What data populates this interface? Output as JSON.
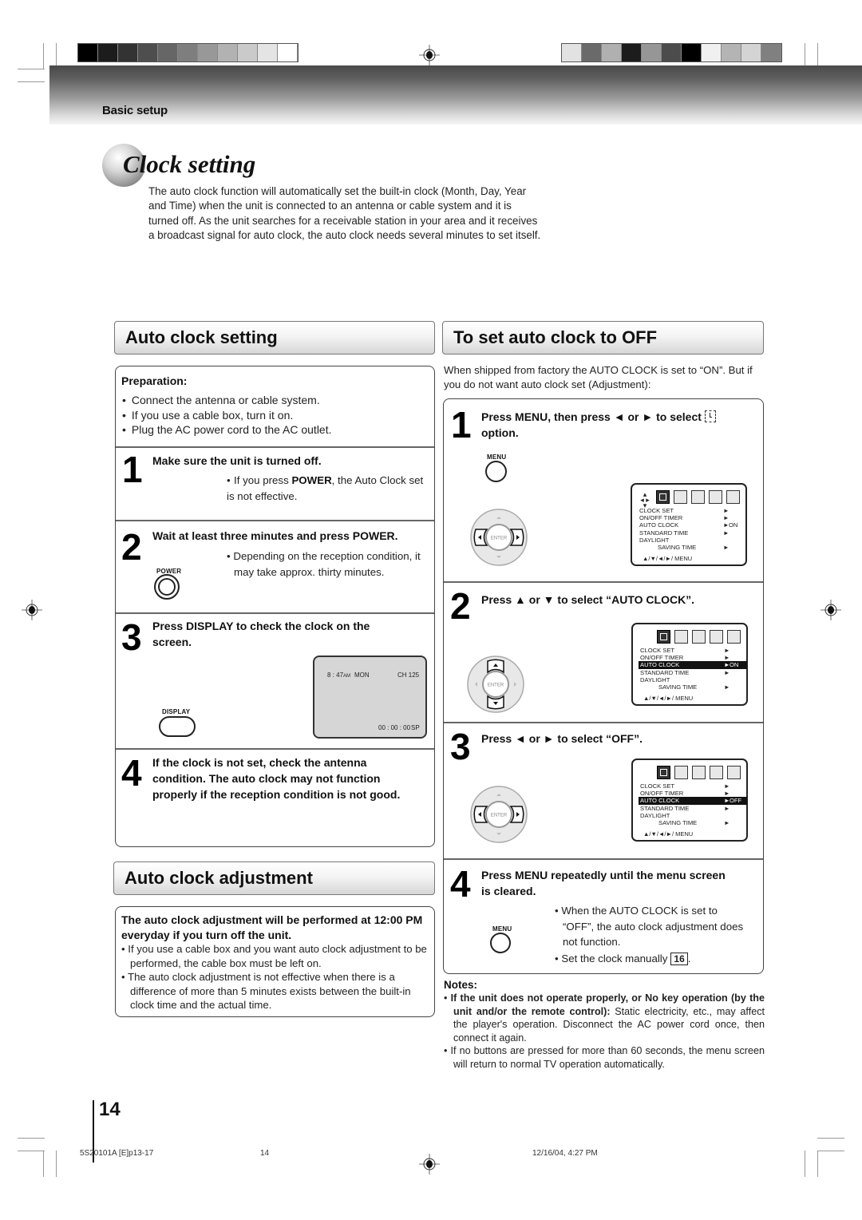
{
  "header": {
    "section_label": "Basic setup",
    "calibration_left": [
      "#000000",
      "#1c1c1c",
      "#333333",
      "#4e4e4e",
      "#666666",
      "#7e7e7e",
      "#989898",
      "#b2b2b2",
      "#cacaca",
      "#e4e4e4",
      "#ffffff"
    ],
    "calibration_right": [
      "#e2e2e2",
      "#6a6a6a",
      "#b0b0b0",
      "#1c1c1c",
      "#969696",
      "#4c4c4c",
      "#000000",
      "#f0f0f0",
      "#b4b4b4",
      "#d4d4d4",
      "#808080"
    ]
  },
  "title": "Clock setting",
  "intro": "The auto clock function will automatically set the built-in clock (Month, Day, Year and Time) when the unit is connected to an antenna or cable system and it is turned off. As the unit searches for a receivable station in your area and it receives a broadcast signal for auto clock, the auto clock needs several minutes to set itself.",
  "auto_clock_setting": {
    "heading": "Auto clock setting",
    "preparation": {
      "heading": "Preparation:",
      "items": [
        "Connect the antenna or cable system.",
        "If you use a cable box, turn it on.",
        "Plug the AC power cord to the AC outlet."
      ]
    },
    "steps": [
      {
        "number": "1",
        "title": "Make sure the unit is turned off.",
        "note_prefix": "If you press ",
        "note_bold": "POWER",
        "note_suffix": ", the Auto Clock set is not effective."
      },
      {
        "number": "2",
        "title": "Wait at least three minutes and press POWER.",
        "note": "Depending on the reception condition, it may take approx. thirty minutes.",
        "button_label": "POWER"
      },
      {
        "number": "3",
        "title": "Press DISPLAY to check the clock on the screen.",
        "button_label": "DISPLAY",
        "screen": {
          "time": "8 : 47",
          "ampm": "AM",
          "day": "MON",
          "channel": "CH  125",
          "counter": "00 : 00 : 00",
          "speed": "SP"
        }
      },
      {
        "number": "4",
        "title": "If the clock is not set, check the antenna condition. The auto clock may not function properly if the reception condition is not good."
      }
    ]
  },
  "auto_clock_adjustment": {
    "heading": "Auto clock adjustment",
    "lead": "The auto clock adjustment will be performed at 12:00 PM everyday if you turn off the unit.",
    "items": [
      "If you use a cable box and you want auto clock adjustment to be performed, the cable box must be left on.",
      "The auto clock adjustment is not effective when there is a difference of more than 5 minutes exists between the built-in clock time and the actual time."
    ]
  },
  "auto_clock_off": {
    "heading": "To set auto clock to OFF",
    "intro": "When shipped from factory the AUTO CLOCK is set to “ON”. But if you do not want auto clock set (Adjustment):",
    "steps": [
      {
        "number": "1",
        "title_a": "Press MENU, then press ◄ or ► to select",
        "title_b": "option.",
        "button_label": "MENU",
        "auto_clock_value": "ON",
        "highlight": false
      },
      {
        "number": "2",
        "title": "Press ▲ or ▼ to select “AUTO CLOCK”.",
        "auto_clock_value": "ON",
        "highlight": true
      },
      {
        "number": "3",
        "title": "Press ◄ or ► to select “OFF”.",
        "auto_clock_value": "OFF",
        "highlight": true
      },
      {
        "number": "4",
        "title": "Press MENU repeatedly until the menu screen is cleared.",
        "button_label": "MENU",
        "notes": [
          "When the AUTO CLOCK is set to “OFF”, the auto clock adjustment does not function.",
          "Set the clock manually"
        ],
        "page_ref": "16"
      }
    ],
    "menu": {
      "rows": [
        "CLOCK  SET",
        "ON/OFF  TIMER",
        "AUTO  CLOCK",
        "STANDARD  TIME",
        "DAYLIGHT",
        "SAVING  TIME"
      ],
      "footer": "▲/▼/◄/►/ MENU",
      "enter_label": "ENTER"
    }
  },
  "notes": {
    "heading": "Notes:",
    "items": [
      {
        "bold": "If the unit does not operate properly, or No key operation (by the unit and/or the remote control):",
        "text": " Static electricity, etc., may affect the player's operation. Disconnect the AC power cord once, then connect it again."
      },
      {
        "bold": "",
        "text": "If no buttons are pressed for more than 60 seconds, the menu screen will return to normal TV operation automatically."
      }
    ]
  },
  "page_number": "14",
  "footer": {
    "file": "5S20101A [E]p13-17",
    "page": "14",
    "timestamp": "12/16/04, 4:27 PM"
  }
}
